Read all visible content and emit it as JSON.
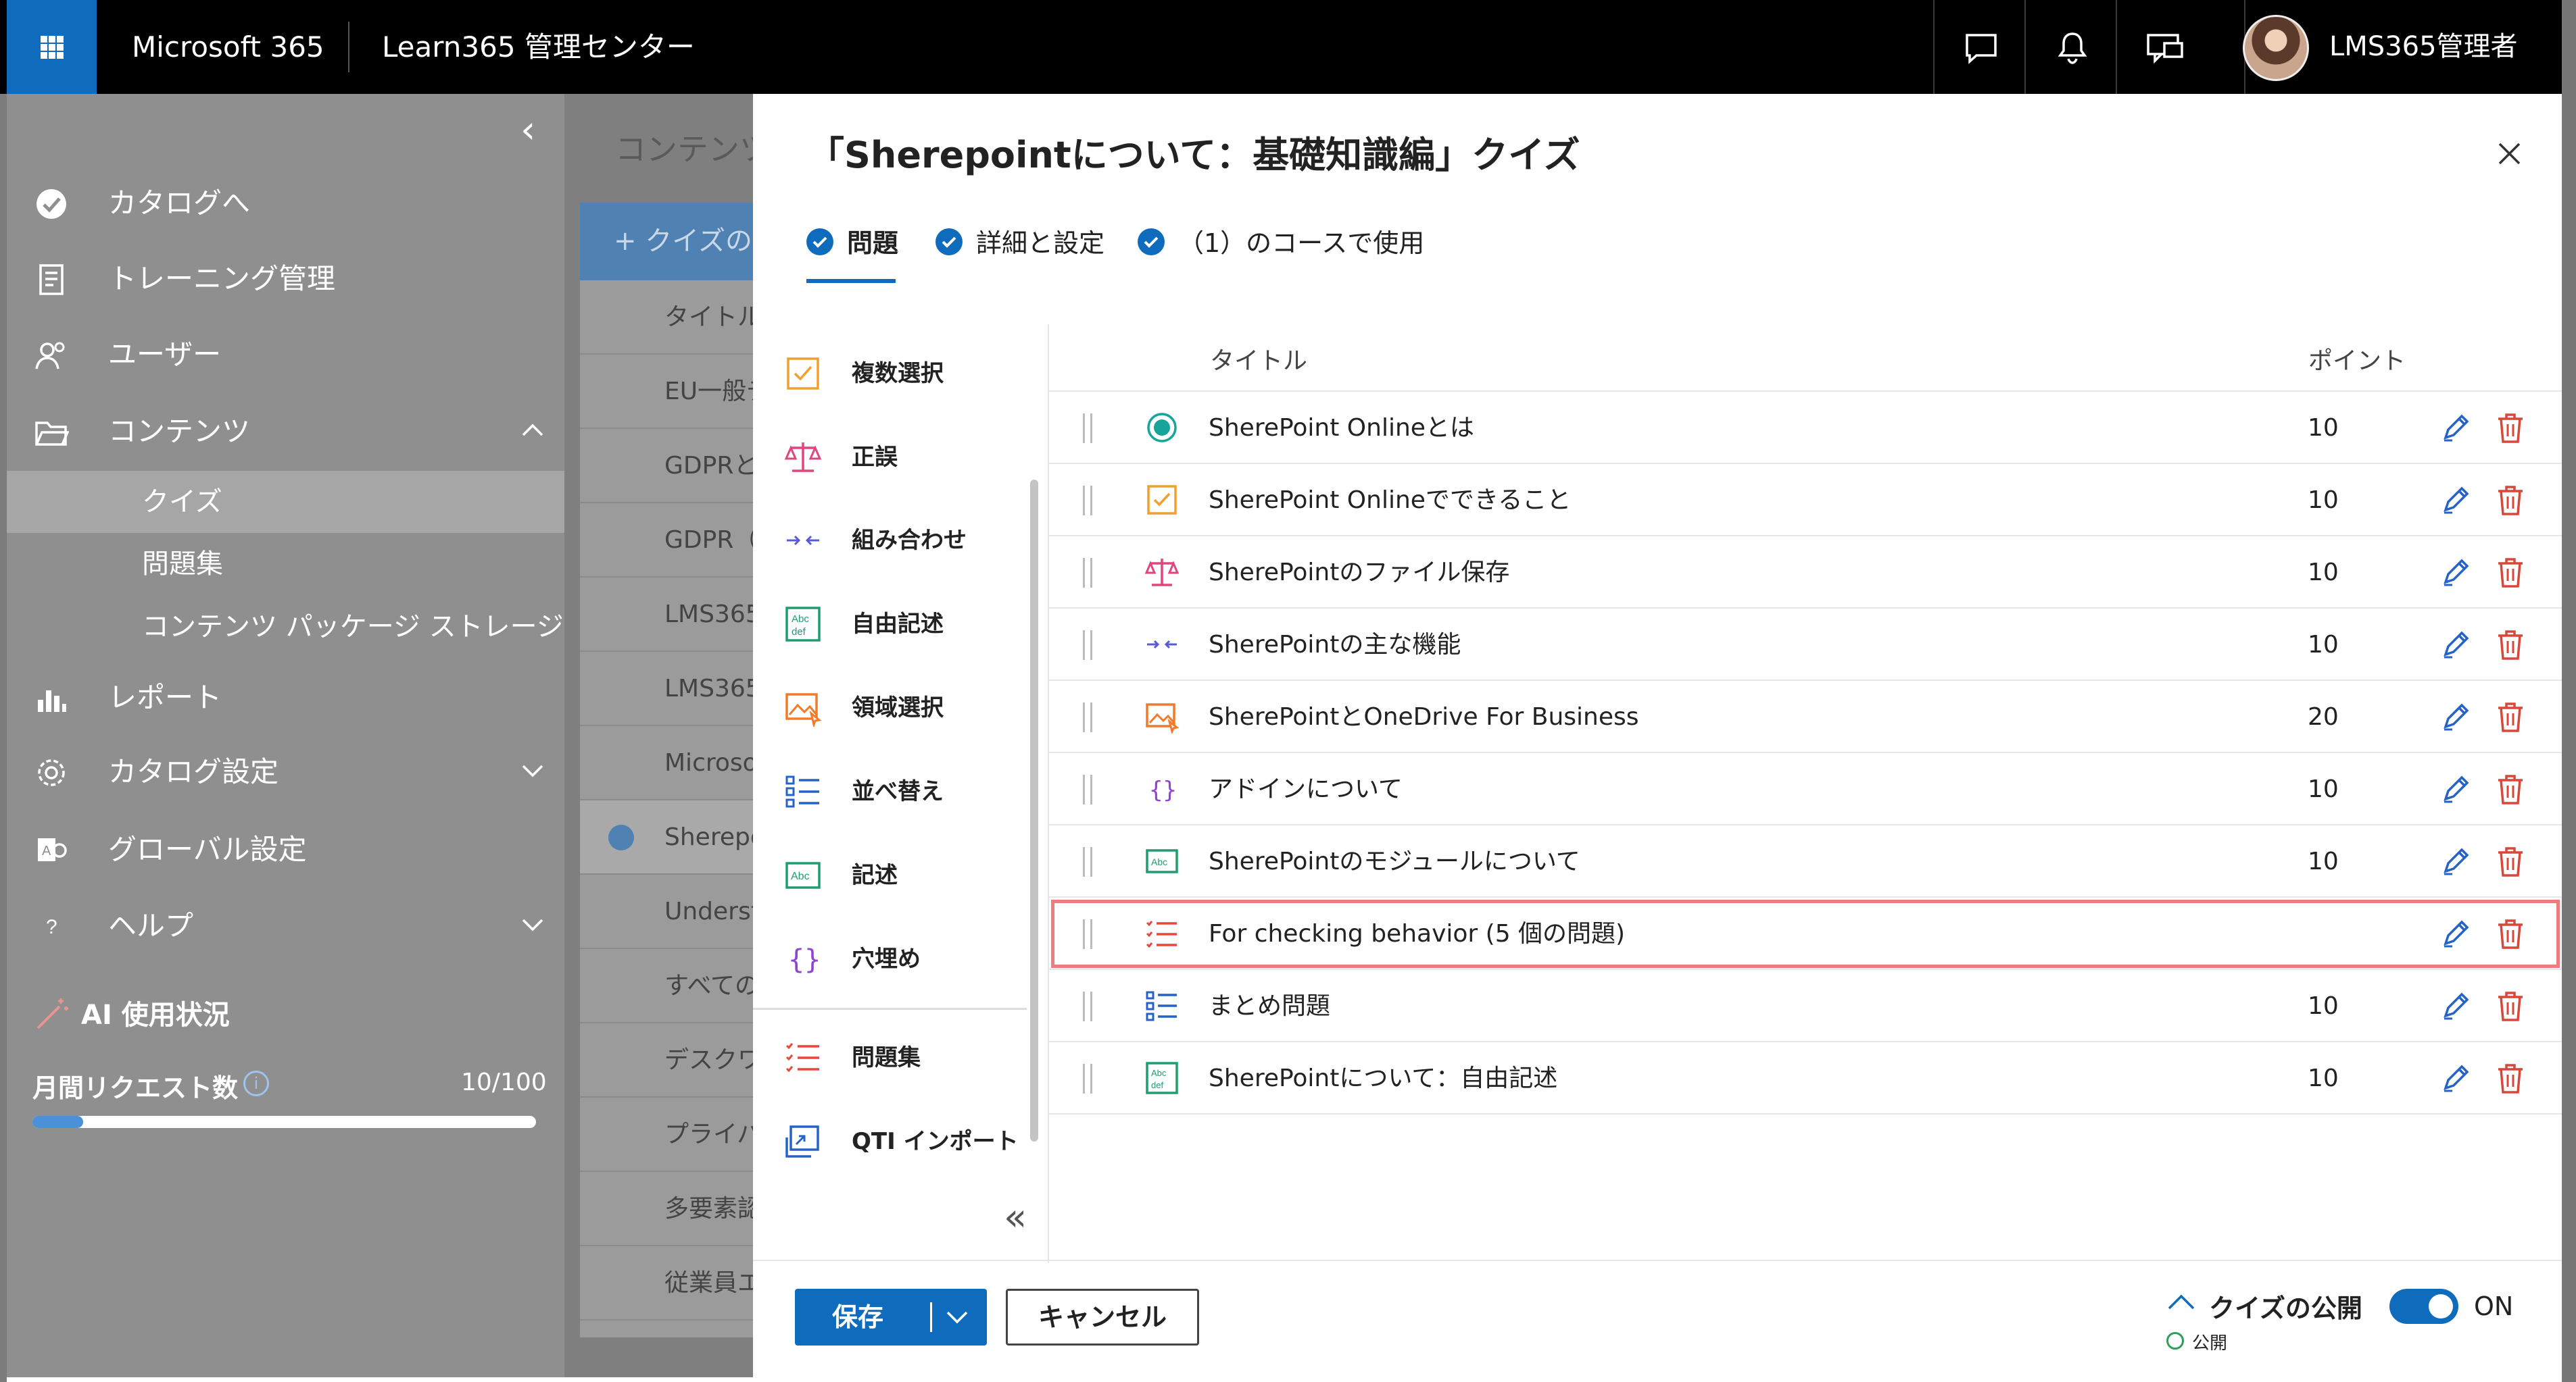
{
  "header": {
    "brand": "Microsoft 365",
    "app_title": "Learn365 管理センター",
    "user_name": "LMS365管理者",
    "icons": [
      "app-launcher-icon",
      "chat-icon",
      "bell-icon",
      "feedback-icon"
    ]
  },
  "sidebar": {
    "items": [
      {
        "label": "カタログへ",
        "icon": "catalog-check-icon"
      },
      {
        "label": "トレーニング管理",
        "icon": "document-icon"
      },
      {
        "label": "ユーザー",
        "icon": "users-icon"
      },
      {
        "label": "コンテンツ",
        "icon": "folder-open-icon"
      },
      {
        "label": "レポート",
        "icon": "bar-chart-icon"
      },
      {
        "label": "カタログ設定",
        "icon": "gear-icon"
      },
      {
        "label": "グローバル設定",
        "icon": "global-settings-icon"
      },
      {
        "label": "ヘルプ",
        "icon": "question-icon"
      }
    ],
    "sub_items": [
      {
        "label": "クイズ"
      },
      {
        "label": "問題集"
      },
      {
        "label": "コンテンツ パッケージ ストレージ"
      }
    ],
    "ai_usage": {
      "label": "AI 使用状況",
      "requests_label": "月間リクエスト数",
      "requests_count": "10/100",
      "used": 10,
      "limit": 100
    }
  },
  "background": {
    "title": "コンテンツ",
    "add_button": "+ クイズの",
    "rows": [
      "タイトル",
      "EU一般デ",
      "GDPRと",
      "GDPR（",
      "LMS365",
      "LMS365",
      "Microso",
      "Sherepo",
      "Understa",
      "すべての",
      "デスクワ",
      "プライバ",
      "多要素認",
      "従業員エ"
    ]
  },
  "panel": {
    "title": "「Sherepointについて：基礎知識編」クイズ",
    "tabs": [
      {
        "label": "問題"
      },
      {
        "label": "詳細と設定"
      },
      {
        "label": "（1）のコースで使用"
      }
    ],
    "palette": [
      {
        "label": "複数選択",
        "icon": "checkbox-icon"
      },
      {
        "label": "正誤",
        "icon": "scales-icon"
      },
      {
        "label": "組み合わせ",
        "icon": "match-arrows-icon"
      },
      {
        "label": "自由記述",
        "icon": "abc-def-icon"
      },
      {
        "label": "領域選択",
        "icon": "area-select-icon"
      },
      {
        "label": "並べ替え",
        "icon": "ordered-list-icon"
      },
      {
        "label": "記述",
        "icon": "abc-icon"
      },
      {
        "label": "穴埋め",
        "icon": "braces-icon"
      },
      {
        "label": "問題集",
        "icon": "question-set-icon"
      },
      {
        "label": "QTI インポート",
        "icon": "import-icon"
      }
    ],
    "columns": {
      "title": "タイトル",
      "points": "ポイント"
    },
    "questions": [
      {
        "title": "SherePoint Onlineとは",
        "points": "10",
        "icon": "radio-icon"
      },
      {
        "title": "SherePoint Onlineでできること",
        "points": "10",
        "icon": "checkbox-icon"
      },
      {
        "title": "SherePointのファイル保存",
        "points": "10",
        "icon": "scales-icon"
      },
      {
        "title": "SherePointの主な機能",
        "points": "10",
        "icon": "match-arrows-icon"
      },
      {
        "title": "SherePointとOneDrive For Business",
        "points": "20",
        "icon": "area-select-icon"
      },
      {
        "title": "アドインについて",
        "points": "10",
        "icon": "braces-icon"
      },
      {
        "title": "SherePointのモジュールについて",
        "points": "10",
        "icon": "abc-icon"
      },
      {
        "title": "For checking behavior (5 個の問題)",
        "points": "",
        "icon": "question-set-icon",
        "highlighted": true
      },
      {
        "title": "まとめ問題",
        "points": "10",
        "icon": "ordered-list-icon"
      },
      {
        "title": "SherePointについて：自由記述",
        "points": "10",
        "icon": "abc-def-icon"
      }
    ],
    "footer": {
      "save": "保存",
      "cancel": "キャンセル",
      "publish_label": "クイズの公開",
      "publish_status": "公開",
      "toggle_label": "ON",
      "toggle_on": true
    }
  },
  "colors": {
    "accent": "#0f6cbd",
    "highlight_border": "#ee7b7d",
    "delete": "#d9473a",
    "topbar": "#000000"
  }
}
